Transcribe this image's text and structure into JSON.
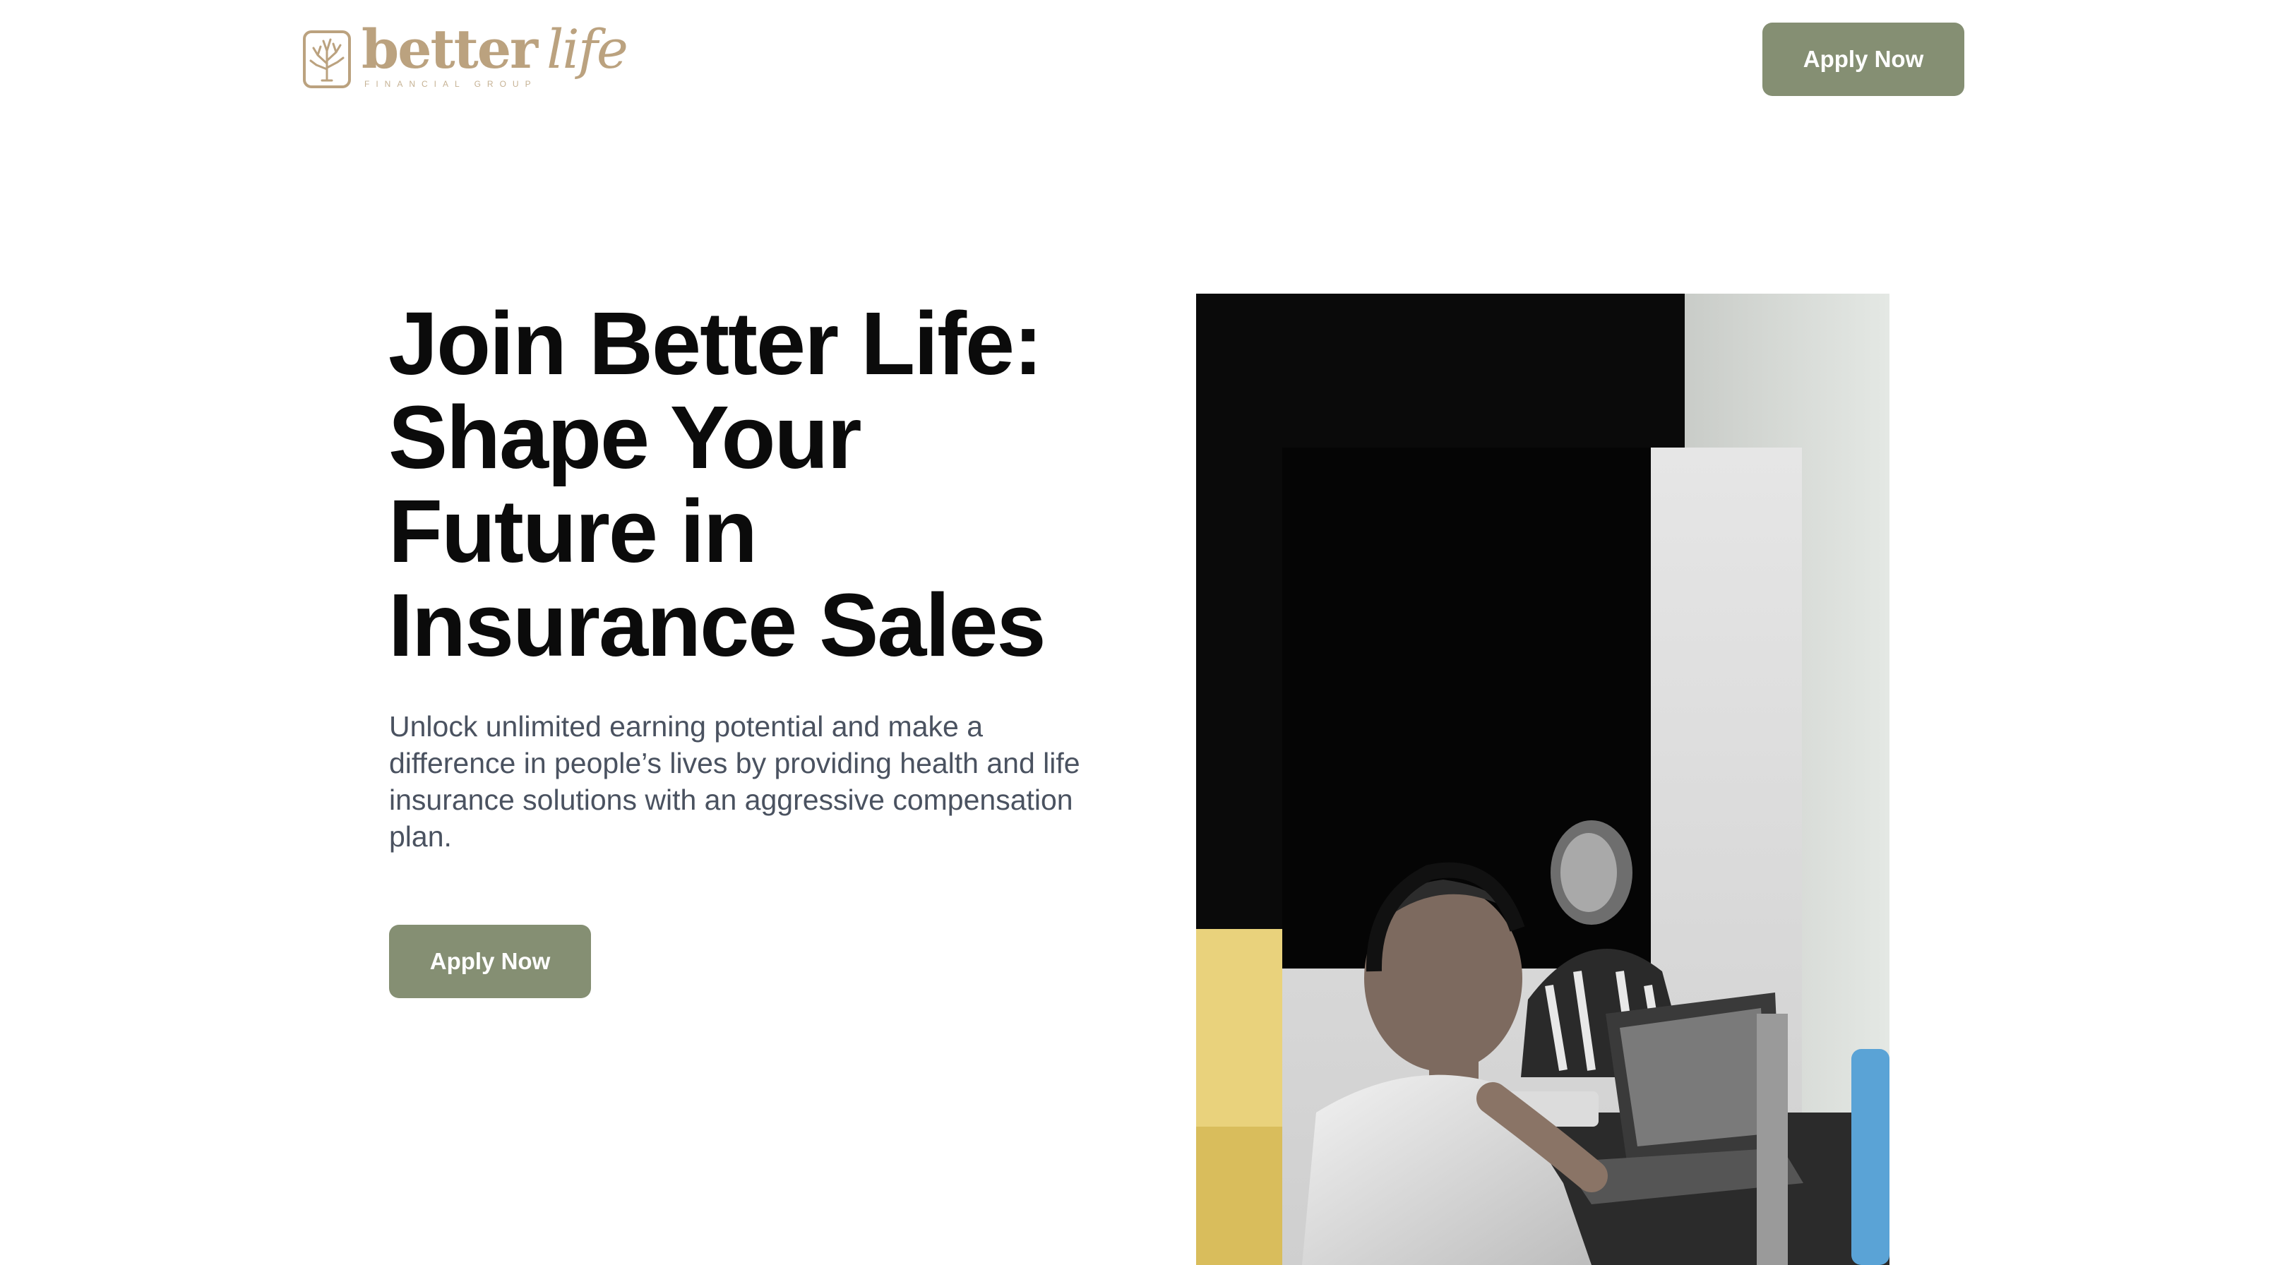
{
  "header": {
    "logo": {
      "word_main": "better",
      "word_accent": "life",
      "tagline": "FINANCIAL GROUP",
      "icon": "tree-icon"
    },
    "apply_label": "Apply Now"
  },
  "hero": {
    "title": "Join Better Life: Shape Your Future in Insurance Sales",
    "subtitle": "Unlock unlimited earning potential and make a difference in people’s lives by providing health and life insurance solutions with an aggressive compensation plan.",
    "apply_label": "Apply Now",
    "image_icon": "team-meeting-photo"
  },
  "colors": {
    "brand_gold": "#bba27f",
    "button_green": "#858f73",
    "title_text": "#0b0b0b",
    "body_text": "#4a5260"
  }
}
